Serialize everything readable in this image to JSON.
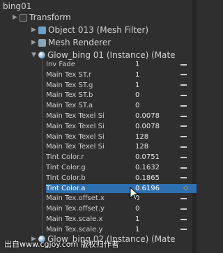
{
  "hierarchy": {
    "root": "bing01",
    "components": [
      {
        "label": "Transform",
        "icon": "transform-icon"
      },
      {
        "label": "Object 013 (Mesh Filter)",
        "icon": "mesh-filter-icon"
      },
      {
        "label": "Mesh Renderer",
        "icon": "mesh-renderer-icon"
      },
      {
        "label": "Glow_bing 01 (Instance) (Mate",
        "icon": "material-icon"
      }
    ],
    "bottom_item": "Glow_bing 02 (Instance) (Mate"
  },
  "properties": [
    {
      "name": "Inv Fade",
      "value": "1"
    },
    {
      "name": "Main Tex  ST.r",
      "value": "1"
    },
    {
      "name": "Main Tex  ST.g",
      "value": "1"
    },
    {
      "name": "Main Tex  ST.b",
      "value": "0"
    },
    {
      "name": "Main Tex  ST.a",
      "value": "0"
    },
    {
      "name": "Main Tex  Texel Si",
      "value": "0.0078"
    },
    {
      "name": "Main Tex  Texel Si",
      "value": "0.0078"
    },
    {
      "name": "Main Tex  Texel Si",
      "value": "128"
    },
    {
      "name": "Main Tex  Texel Si",
      "value": "128"
    },
    {
      "name": "Tint Color.r",
      "value": "0.0751"
    },
    {
      "name": "Tint Color.g",
      "value": "0.1632"
    },
    {
      "name": "Tint Color.b",
      "value": "0.1865"
    },
    {
      "name": "Tint Color.a",
      "value": "0.6196"
    },
    {
      "name": "Main Tex.offset.x",
      "value": "0"
    },
    {
      "name": "Main Tex.offset.y",
      "value": "0"
    },
    {
      "name": "Main Tex.scale.x",
      "value": "1"
    },
    {
      "name": "Main Tex.scale.y",
      "value": "1"
    }
  ],
  "selected_property": "Tint Color.a",
  "watermark": "出自www.cgjoy.com 版权归作者",
  "colors": {
    "background": "#2f2f2f",
    "selection": "#2d6fb0",
    "keyframe": "#e8b030"
  }
}
